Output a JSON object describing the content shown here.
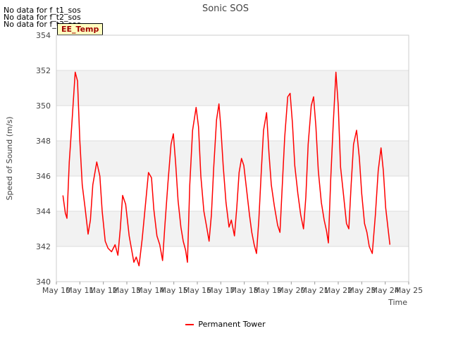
{
  "notices": [
    "No data for f_t1_sos",
    "No data for f_t2_sos",
    "No data for f_t3_sos"
  ],
  "tag_label": "EE_Temp",
  "colors": {
    "series": "#ff0000",
    "band": "#f2f2f2",
    "grid": "#dddddd"
  },
  "chart_data": {
    "type": "line",
    "title": "Sonic SOS",
    "xlabel": "Time",
    "ylabel": "Speed of Sound (m/s)",
    "ylim": [
      340,
      354
    ],
    "yticks": [
      340,
      342,
      344,
      346,
      348,
      350,
      352,
      354
    ],
    "xlim": [
      10,
      25
    ],
    "xticks": [
      {
        "value": 10,
        "label": "May 10"
      },
      {
        "value": 11,
        "label": "May 11"
      },
      {
        "value": 12,
        "label": "May 12"
      },
      {
        "value": 13,
        "label": "May 13"
      },
      {
        "value": 14,
        "label": "May 14"
      },
      {
        "value": 15,
        "label": "May 15"
      },
      {
        "value": 16,
        "label": "May 16"
      },
      {
        "value": 17,
        "label": "May 17"
      },
      {
        "value": 18,
        "label": "May 18"
      },
      {
        "value": 19,
        "label": "May 19"
      },
      {
        "value": 20,
        "label": "May 20"
      },
      {
        "value": 21,
        "label": "May 21"
      },
      {
        "value": 22,
        "label": "May 22"
      },
      {
        "value": 23,
        "label": "May 23"
      },
      {
        "value": 24,
        "label": "May 24"
      },
      {
        "value": 25,
        "label": "May 25"
      }
    ],
    "legend": "bottom-center",
    "series": [
      {
        "name": "Permanent Tower",
        "color": "#ff0000",
        "points": [
          [
            10.28,
            344.9
          ],
          [
            10.38,
            343.9
          ],
          [
            10.45,
            343.6
          ],
          [
            10.55,
            346.8
          ],
          [
            10.65,
            348.8
          ],
          [
            10.8,
            351.9
          ],
          [
            10.9,
            351.4
          ],
          [
            11.0,
            348.0
          ],
          [
            11.1,
            345.5
          ],
          [
            11.22,
            344.2
          ],
          [
            11.35,
            342.7
          ],
          [
            11.45,
            343.5
          ],
          [
            11.55,
            345.5
          ],
          [
            11.72,
            346.8
          ],
          [
            11.85,
            346.0
          ],
          [
            11.95,
            344.0
          ],
          [
            12.08,
            342.3
          ],
          [
            12.2,
            341.9
          ],
          [
            12.35,
            341.7
          ],
          [
            12.5,
            342.1
          ],
          [
            12.62,
            341.5
          ],
          [
            12.72,
            343.0
          ],
          [
            12.82,
            344.9
          ],
          [
            12.95,
            344.4
          ],
          [
            13.1,
            342.6
          ],
          [
            13.22,
            341.7
          ],
          [
            13.3,
            341.1
          ],
          [
            13.4,
            341.4
          ],
          [
            13.52,
            340.9
          ],
          [
            13.65,
            342.4
          ],
          [
            13.8,
            344.5
          ],
          [
            13.92,
            346.2
          ],
          [
            14.05,
            345.9
          ],
          [
            14.15,
            344.1
          ],
          [
            14.28,
            342.6
          ],
          [
            14.4,
            342.1
          ],
          [
            14.52,
            341.2
          ],
          [
            14.62,
            343.2
          ],
          [
            14.75,
            345.6
          ],
          [
            14.88,
            347.8
          ],
          [
            14.98,
            348.4
          ],
          [
            15.08,
            346.7
          ],
          [
            15.18,
            344.6
          ],
          [
            15.3,
            343.1
          ],
          [
            15.4,
            342.3
          ],
          [
            15.5,
            341.8
          ],
          [
            15.58,
            341.1
          ],
          [
            15.68,
            345.5
          ],
          [
            15.8,
            348.6
          ],
          [
            15.95,
            349.9
          ],
          [
            16.05,
            348.8
          ],
          [
            16.15,
            346.0
          ],
          [
            16.28,
            344.0
          ],
          [
            16.4,
            343.1
          ],
          [
            16.5,
            342.3
          ],
          [
            16.6,
            343.8
          ],
          [
            16.7,
            346.5
          ],
          [
            16.82,
            349.2
          ],
          [
            16.92,
            350.1
          ],
          [
            17.0,
            348.8
          ],
          [
            17.1,
            346.6
          ],
          [
            17.22,
            344.5
          ],
          [
            17.35,
            343.1
          ],
          [
            17.45,
            343.5
          ],
          [
            17.58,
            342.6
          ],
          [
            17.68,
            344.2
          ],
          [
            17.78,
            346.2
          ],
          [
            17.88,
            347.0
          ],
          [
            17.98,
            346.6
          ],
          [
            18.1,
            345.2
          ],
          [
            18.22,
            343.8
          ],
          [
            18.32,
            342.8
          ],
          [
            18.42,
            342.1
          ],
          [
            18.52,
            341.6
          ],
          [
            18.62,
            343.5
          ],
          [
            18.72,
            346.2
          ],
          [
            18.82,
            348.6
          ],
          [
            18.95,
            349.6
          ],
          [
            19.05,
            347.3
          ],
          [
            19.15,
            345.5
          ],
          [
            19.28,
            344.3
          ],
          [
            19.42,
            343.2
          ],
          [
            19.52,
            342.8
          ],
          [
            19.6,
            345.0
          ],
          [
            19.72,
            348.2
          ],
          [
            19.85,
            350.5
          ],
          [
            19.95,
            350.7
          ],
          [
            20.05,
            349.0
          ],
          [
            20.15,
            346.6
          ],
          [
            20.28,
            345.0
          ],
          [
            20.4,
            343.8
          ],
          [
            20.52,
            343.0
          ],
          [
            20.62,
            344.8
          ],
          [
            20.72,
            347.8
          ],
          [
            20.85,
            350.0
          ],
          [
            20.95,
            350.5
          ],
          [
            21.05,
            348.8
          ],
          [
            21.15,
            346.3
          ],
          [
            21.28,
            344.5
          ],
          [
            21.4,
            343.5
          ],
          [
            21.5,
            342.9
          ],
          [
            21.58,
            342.2
          ],
          [
            21.68,
            345.8
          ],
          [
            21.78,
            348.8
          ],
          [
            21.9,
            351.9
          ],
          [
            22.0,
            350.0
          ],
          [
            22.1,
            346.5
          ],
          [
            22.22,
            345.0
          ],
          [
            22.35,
            343.3
          ],
          [
            22.45,
            343.0
          ],
          [
            22.55,
            345.5
          ],
          [
            22.65,
            347.8
          ],
          [
            22.78,
            348.6
          ],
          [
            22.9,
            347.0
          ],
          [
            23.0,
            345.0
          ],
          [
            23.12,
            343.3
          ],
          [
            23.22,
            342.8
          ],
          [
            23.32,
            342.0
          ],
          [
            23.45,
            341.6
          ],
          [
            23.58,
            343.8
          ],
          [
            23.7,
            346.3
          ],
          [
            23.82,
            347.6
          ],
          [
            23.92,
            346.3
          ],
          [
            24.02,
            344.2
          ],
          [
            24.12,
            343.0
          ],
          [
            24.2,
            342.1
          ]
        ]
      }
    ]
  }
}
